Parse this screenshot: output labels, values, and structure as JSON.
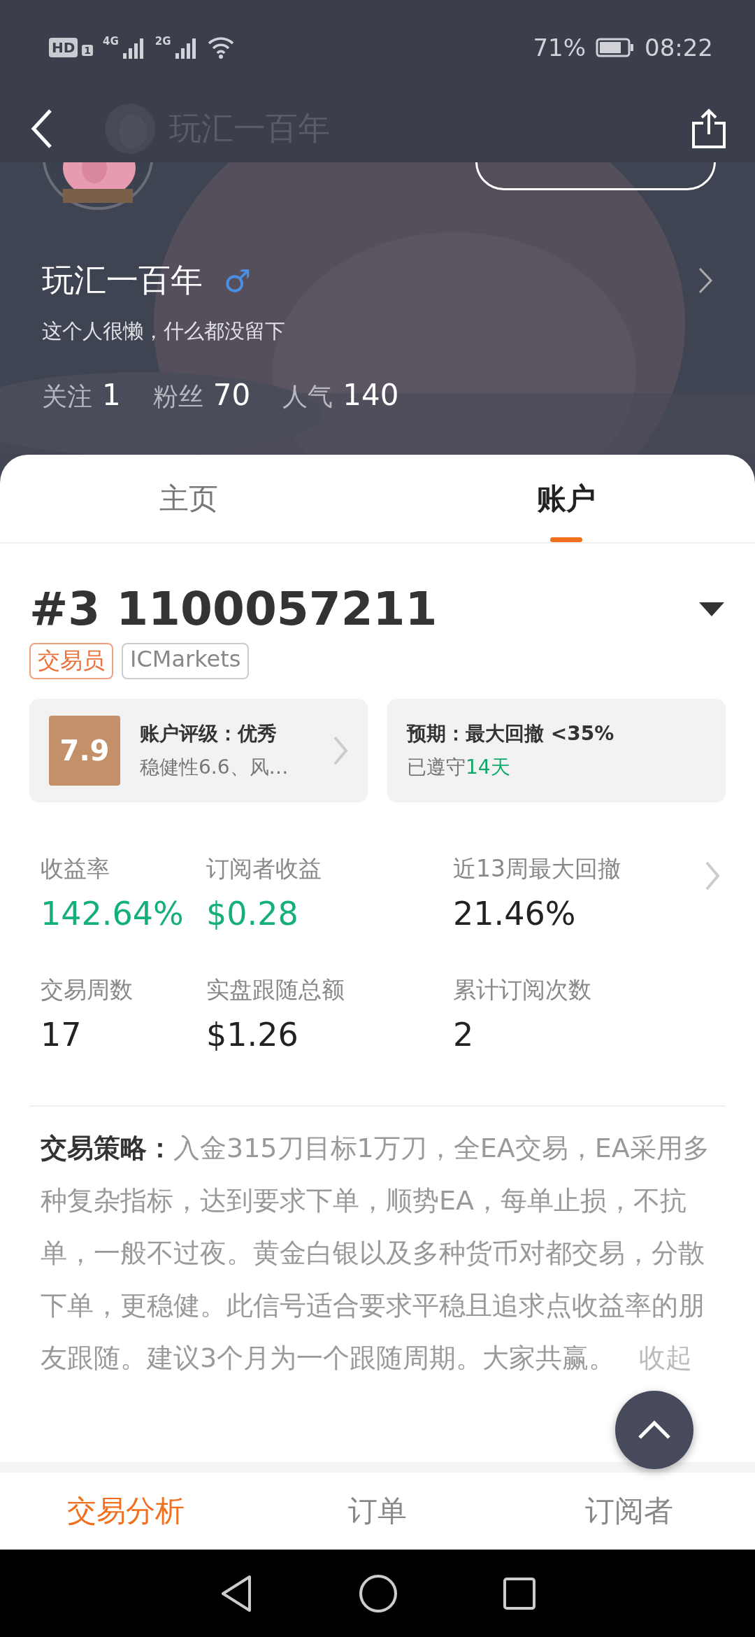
{
  "status_bar": {
    "hd_badge": "HD",
    "sim_badge": "1",
    "networks": [
      "4G",
      "2G"
    ],
    "battery": "71%",
    "time": "08:22"
  },
  "header": {
    "title": "玩汇一百年"
  },
  "profile": {
    "name": "玩汇一百年",
    "gender_symbol": "♂",
    "bio": "这个人很懒，什么都没留下",
    "stats": [
      {
        "label": "关注",
        "value": "1"
      },
      {
        "label": "粉丝",
        "value": "70"
      },
      {
        "label": "人气",
        "value": "140"
      }
    ]
  },
  "tabs": [
    {
      "label": "主页",
      "selected": false
    },
    {
      "label": "账户",
      "selected": true
    }
  ],
  "account": {
    "title": "#3 1100057211",
    "tags": [
      {
        "label": "交易员",
        "kind": "role"
      },
      {
        "label": "ICMarkets",
        "kind": "broker"
      }
    ],
    "rating": {
      "score": "7.9",
      "title": "账户评级：优秀",
      "detail": "稳健性6.6、风…"
    },
    "expectation": {
      "title": "预期：最大回撤 <35%",
      "prefix": "已遵守",
      "days": "14天"
    },
    "metrics": [
      {
        "label": "收益率",
        "value": "142.64%",
        "positive": true
      },
      {
        "label": "订阅者收益",
        "value": "$0.28",
        "positive": true
      },
      {
        "label": "近13周最大回撤",
        "value": "21.46%",
        "positive": false
      },
      {
        "label": "交易周数",
        "value": "17",
        "positive": false
      },
      {
        "label": "实盘跟随总额",
        "value": "$1.26",
        "positive": false
      },
      {
        "label": "累计订阅次数",
        "value": "2",
        "positive": false
      }
    ],
    "strategy": {
      "text": "**交易策略：**入金315刀目标1万刀，全EA交易，EA采用多种复杂指标，达到要求下单，顺势EA，每单止损，不抗单，一般不过夜。黄金白银以及多种货币对都交易，分散下单，更稳健。此信号适合要求平稳且追求点收益率的朋友跟随。建议3个月为一个跟随周期。大家共赢。",
      "collapse": "收起"
    }
  },
  "bottom_tabs": [
    {
      "label": "交易分析",
      "selected": true
    },
    {
      "label": "订单",
      "selected": false
    },
    {
      "label": "订阅者",
      "selected": false
    }
  ]
}
